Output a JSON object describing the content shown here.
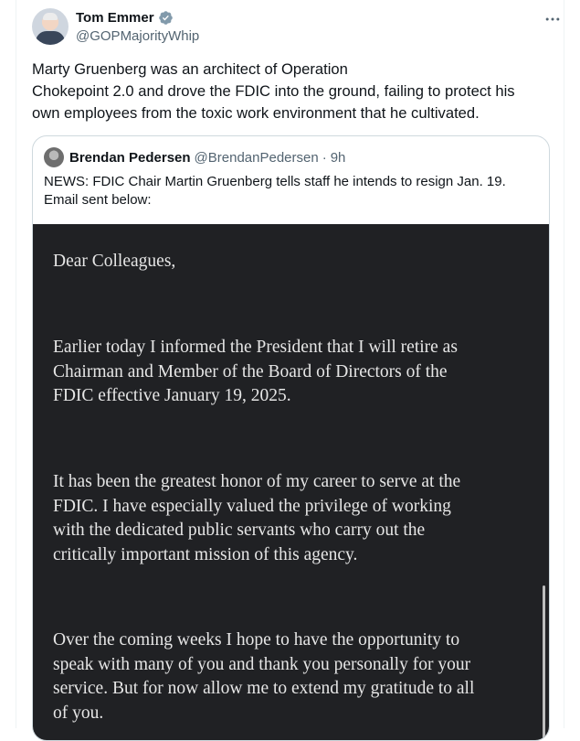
{
  "author": {
    "display_name": "Tom Emmer",
    "handle": "@GOPMajorityWhip",
    "verified_icon": "verified-badge-icon",
    "verified_color": "#829aab"
  },
  "tweet": {
    "text_lines": [
      "Marty Gruenberg was an architect of Operation",
      "Chokepoint 2.0 and drove the FDIC into the ground, failing to protect his",
      "own employees from the toxic work environment that he cultivated."
    ]
  },
  "quote": {
    "display_name": "Brendan Pedersen",
    "handle": "@BrendanPedersen",
    "separator": "·",
    "time": "9h",
    "text_lines": [
      "NEWS: FDIC Chair Martin Gruenberg tells staff he intends to resign Jan. 19.",
      "Email sent below:"
    ]
  },
  "letter": {
    "salutation": "Dear Colleagues,",
    "para1": [
      "Earlier today I informed the President that I will retire as",
      "Chairman and Member of the Board of Directors of the",
      "FDIC effective January 19, 2025."
    ],
    "para2": [
      "It has been the greatest honor of my career to serve at the",
      "FDIC. I have especially valued the privilege of working",
      "with the dedicated public servants who carry out the",
      "critically important mission of this agency."
    ],
    "para3": [
      "Over the coming weeks I hope to have the opportunity to",
      "speak with many of you and thank you personally for your",
      "service. But for now allow me to extend my gratitude to all",
      "of you."
    ]
  },
  "more_icon": "ellipsis-icon"
}
